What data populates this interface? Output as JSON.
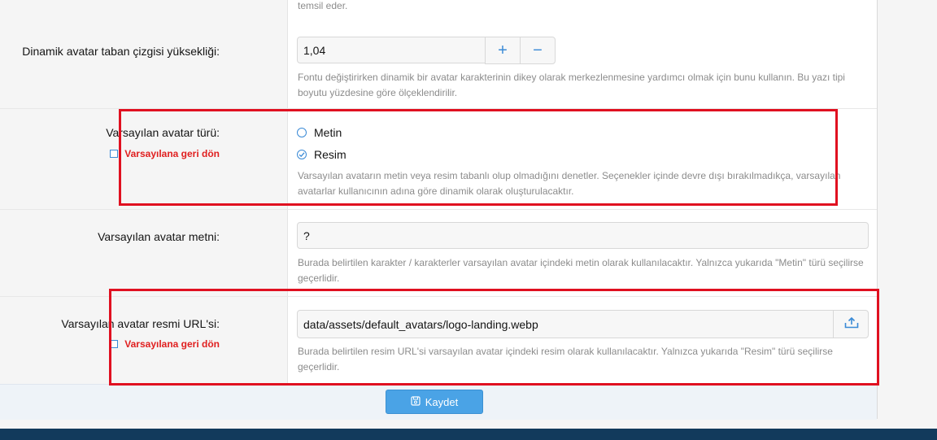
{
  "top_hint_tail": "temsil eder.",
  "baseline": {
    "label": "Dinamik avatar taban çizgisi yüksekliği:",
    "value": "1,04",
    "plus": "+",
    "minus": "−",
    "hint": "Fontu değiştirirken dinamik bir avatar karakterinin dikey olarak merkezlenmesine yardımcı olmak için bunu kullanın. Bu yazı tipi boyutu yüzdesine göre ölçeklendirilir."
  },
  "avatar_type": {
    "label": "Varsayılan avatar türü:",
    "revert": "Varsayılana geri dön",
    "options": [
      "Metin",
      "Resim"
    ],
    "selected": "Resim",
    "hint": "Varsayılan avatarın metin veya resim tabanlı olup olmadığını denetler. Seçenekler içinde devre dışı bırakılmadıkça, varsayılan avatarlar kullanıcının adına göre dinamik olarak oluşturulacaktır."
  },
  "avatar_text": {
    "label": "Varsayılan avatar metni:",
    "value": "?",
    "hint": "Burada belirtilen karakter / karakterler varsayılan avatar içindeki metin olarak kullanılacaktır. Yalnızca yukarıda \"Metin\" türü seçilirse geçerlidir."
  },
  "avatar_url": {
    "label": "Varsayılan avatar resmi URL'si:",
    "revert": "Varsayılana geri dön",
    "value": "data/assets/default_avatars/logo-landing.webp",
    "hint": "Burada belirtilen resim URL'si varsayılan avatar içindeki resim olarak kullanılacaktır. Yalnızca yukarıda \"Resim\" türü seçilirse geçerlidir."
  },
  "footer": {
    "save_label": "Kaydet"
  },
  "colors": {
    "accent": "#3a8ad6",
    "highlight": "#e01020",
    "revert": "#e02020",
    "bottom_bar": "#123a5c"
  }
}
